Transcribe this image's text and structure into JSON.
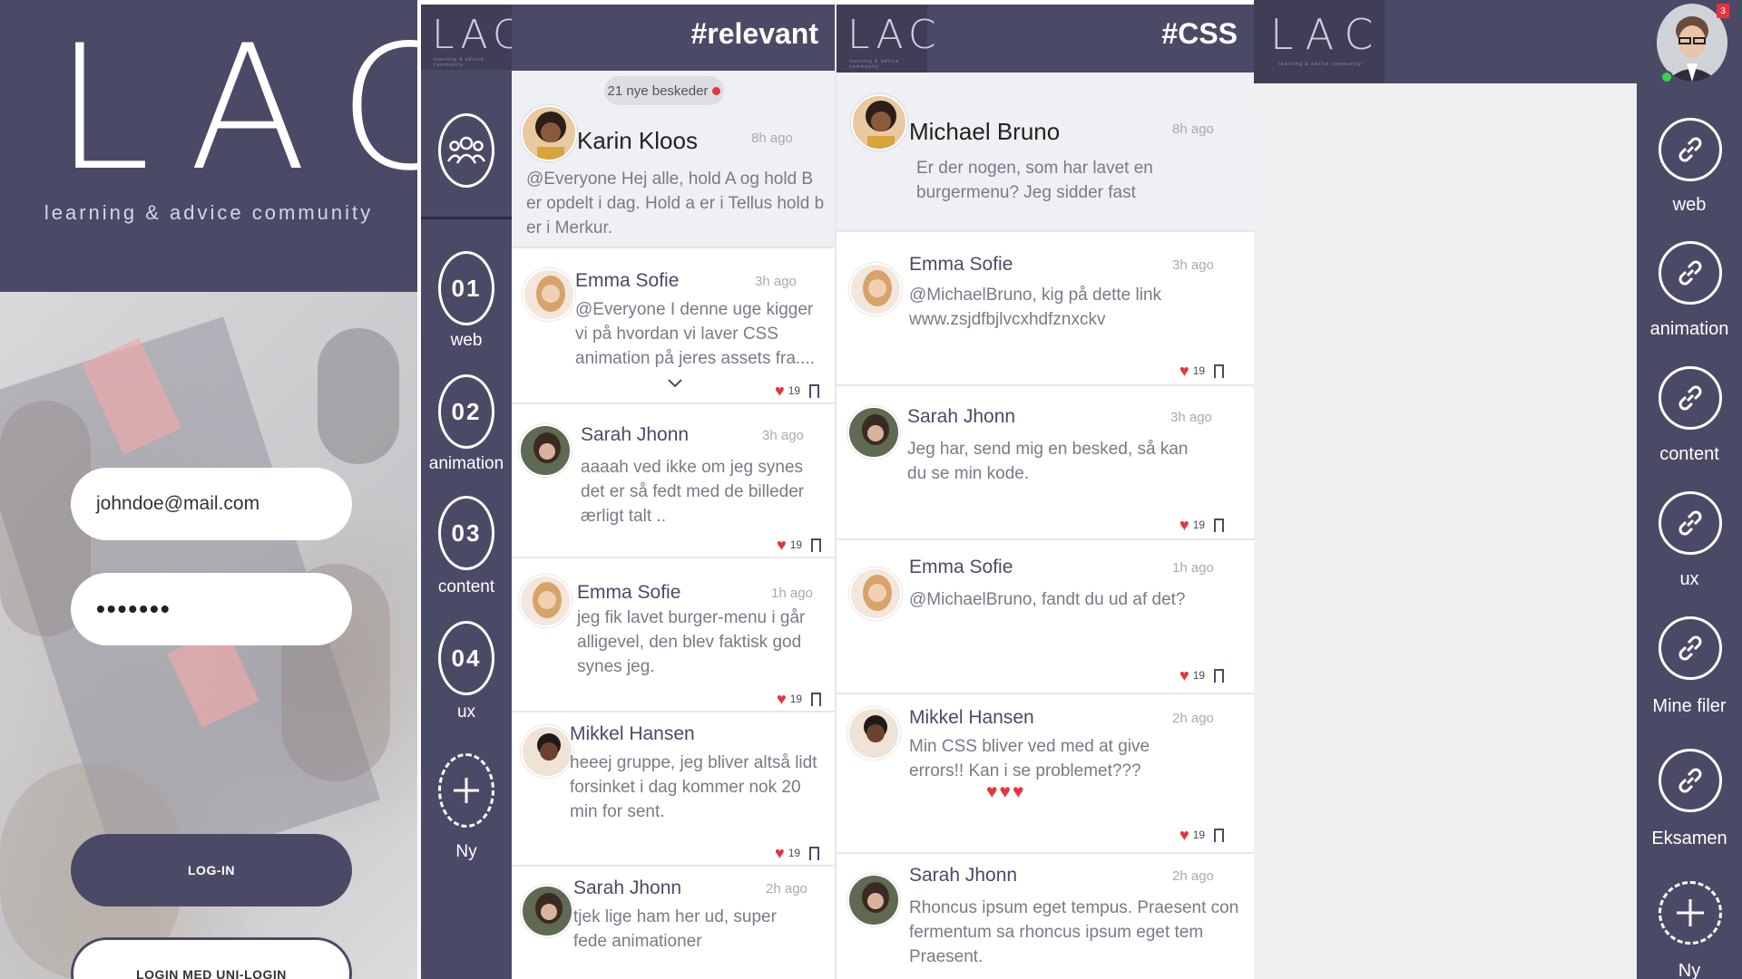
{
  "login": {
    "logo": "LAC",
    "tagline": "learning & advice community",
    "email_value": "johndoe@mail.com",
    "password_value": "•••••••",
    "login_button": "LOG-IN",
    "uni_login_button": "LOGIN MED UNI-LOGIN"
  },
  "logo_small": "LAC",
  "logo_sub": "learning & advice community",
  "rail": {
    "items": [
      {
        "num": "01",
        "label": "web"
      },
      {
        "num": "02",
        "label": "animation"
      },
      {
        "num": "03",
        "label": "content"
      },
      {
        "num": "04",
        "label": "ux"
      }
    ],
    "new_label": "Ny"
  },
  "relevant": {
    "title": "#relevant",
    "new_messages": "21 nye beskeder",
    "posts": [
      {
        "name": "Karin Kloos",
        "time": "8h ago",
        "text": "@Everyone Hej alle, hold A og hold B er opdelt i dag. Hold a er i Tellus hold b er i Merkur."
      },
      {
        "name": "Emma Sofie",
        "time": "3h ago",
        "text": "@Everyone I denne uge kigger vi på hvordan vi laver CSS animation på jeres assets fra....",
        "likes": "19"
      },
      {
        "name": "Sarah Jhonn",
        "time": "3h ago",
        "text": "aaaah ved ikke om jeg synes det er så fedt med de billeder ærligt talt ..",
        "likes": "19"
      },
      {
        "name": "Emma Sofie",
        "time": "1h ago",
        "text": "jeg fik lavet burger-menu i går alligevel, den blev faktisk god synes jeg.",
        "likes": "19"
      },
      {
        "name": "Mikkel Hansen",
        "time": "",
        "text": "heeej gruppe, jeg bliver altså lidt forsinket i dag kommer nok 20 min for sent.",
        "likes": "19"
      },
      {
        "name": "Sarah Jhonn",
        "time": "2h ago",
        "text": "tjek lige ham her ud, super fede animationer"
      }
    ]
  },
  "css": {
    "title": "#CSS",
    "posts": [
      {
        "name": "Michael Bruno",
        "time": "8h ago",
        "text": "Er der nogen, som har lavet en burgermenu? Jeg sidder fast"
      },
      {
        "name": "Emma Sofie",
        "time": "3h ago",
        "text": "@MichaelBruno, kig på dette link www.zsjdfbjlvcxhdfznxckv",
        "likes": "19"
      },
      {
        "name": "Sarah Jhonn",
        "time": "3h ago",
        "text": "Jeg har, send mig en besked, så kan du se min kode.",
        "likes": "19"
      },
      {
        "name": "Emma Sofie",
        "time": "1h ago",
        "text": "@MichaelBruno, fandt du ud af det?",
        "likes": "19"
      },
      {
        "name": "Mikkel Hansen",
        "time": "2h ago",
        "text": "Min CSS bliver ved med at give errors!! Kan i se problemet???",
        "likes": "19",
        "hearts": "♥♥♥"
      },
      {
        "name": "Sarah Jhonn",
        "time": "2h ago",
        "text": "Rhoncus ipsum eget tempus. Praesent con fermentum sa  rhoncus ipsum eget tem Praesent."
      }
    ]
  },
  "right_rail": {
    "notification_count": "3",
    "items": [
      "web",
      "animation",
      "content",
      "ux",
      "Mine filer",
      "Eksamen"
    ],
    "new_label": "Ny"
  },
  "colors": {
    "primary": "#4b4a66",
    "accent": "#e8333c",
    "online": "#3bd24a"
  }
}
